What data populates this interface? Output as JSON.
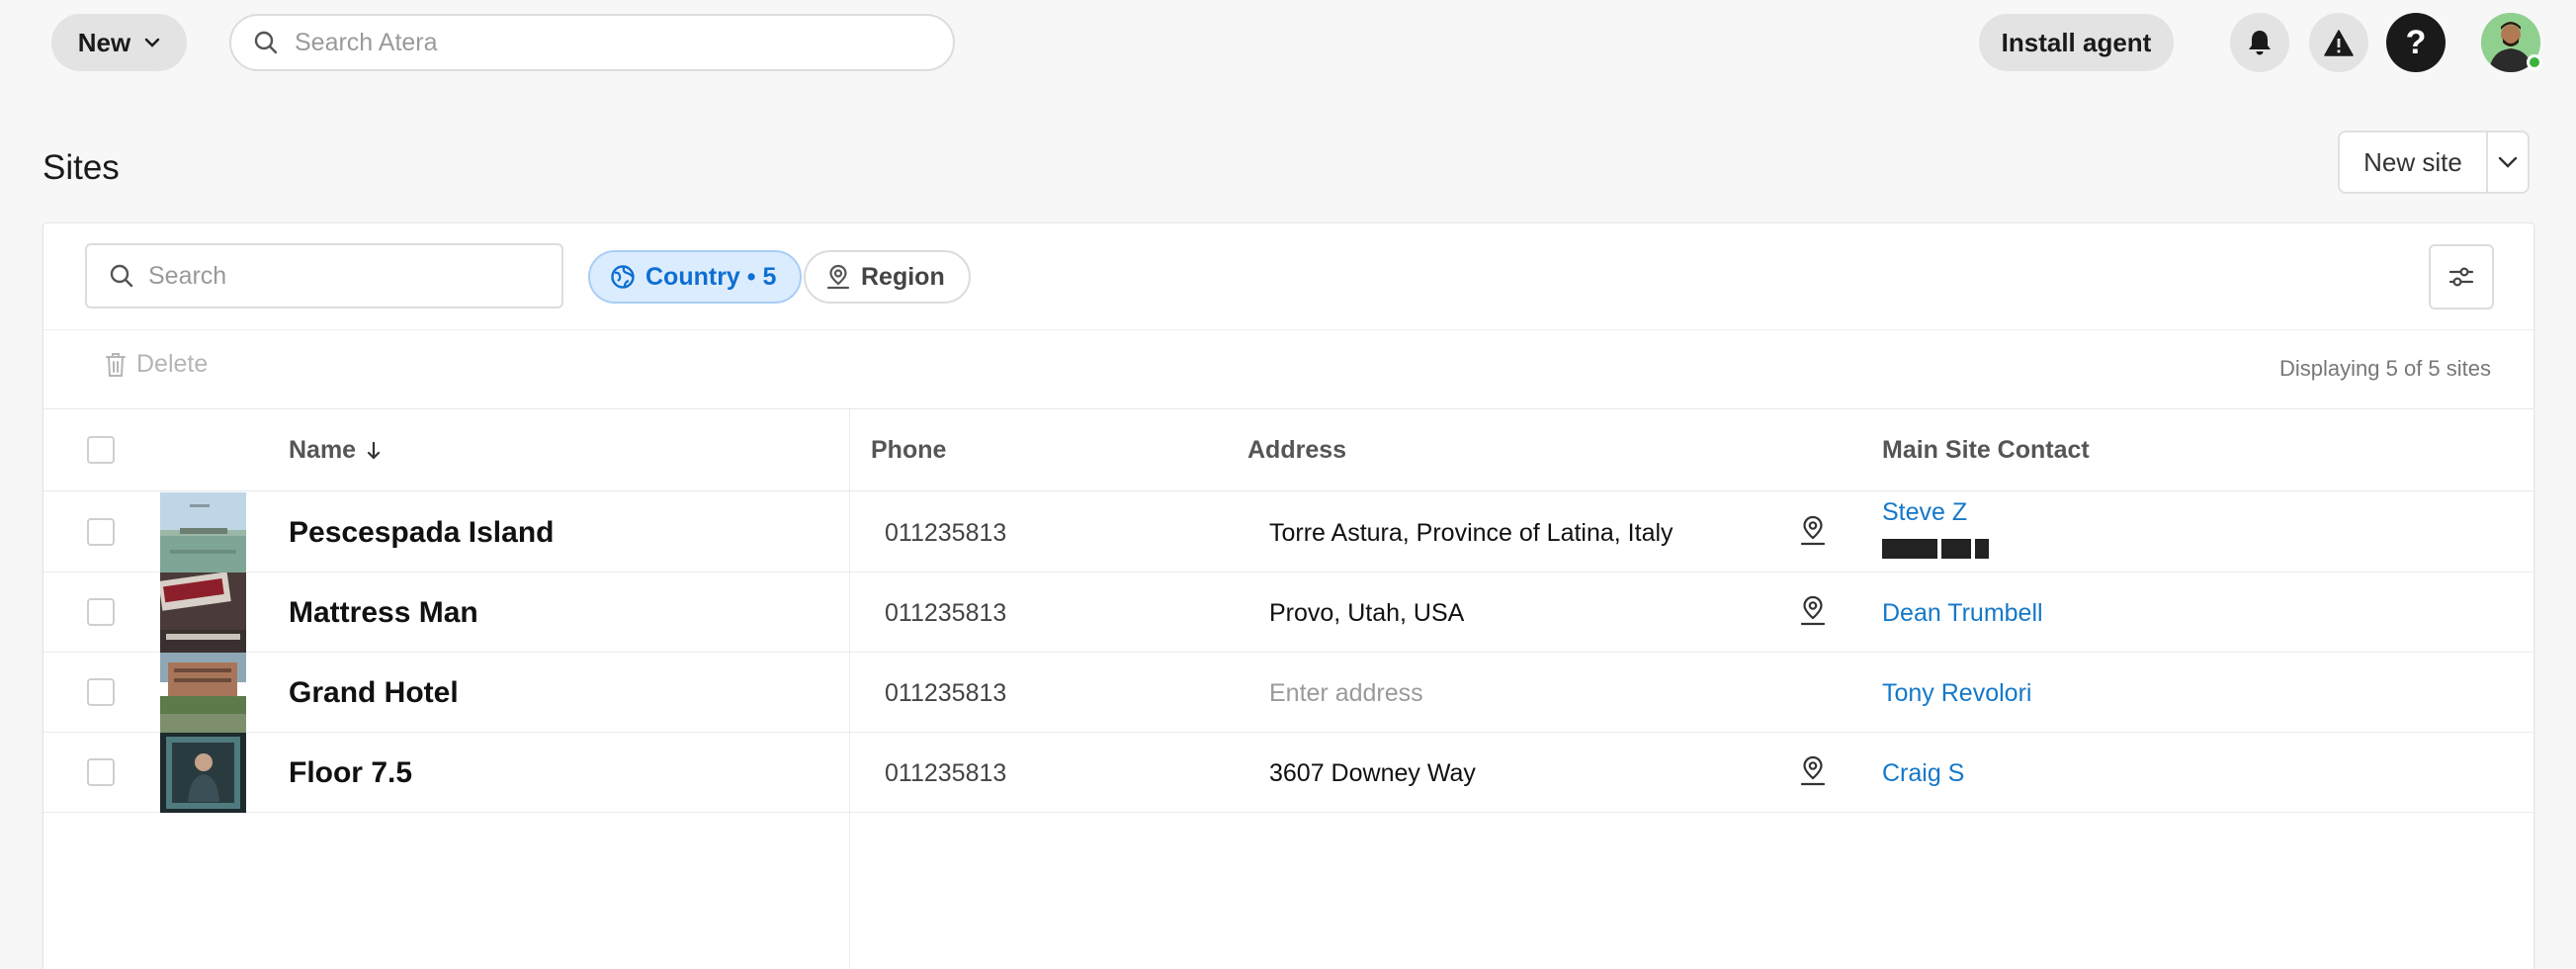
{
  "topbar": {
    "new_label": "New",
    "search_placeholder": "Search Atera",
    "install_agent_label": "Install agent",
    "help_label": "?"
  },
  "page": {
    "title": "Sites",
    "new_site_label": "New site"
  },
  "filters": {
    "search_placeholder": "Search",
    "country_chip": "Country • 5",
    "region_chip": "Region"
  },
  "actions": {
    "delete_label": "Delete",
    "display_count": "Displaying 5 of 5 sites"
  },
  "table": {
    "columns": {
      "name": "Name",
      "phone": "Phone",
      "address": "Address",
      "contact": "Main Site Contact"
    },
    "rows": [
      {
        "name": "Pescespada Island",
        "phone": "011235813",
        "address": "Torre Astura, Province of Latina, Italy",
        "contact": "Steve Z"
      },
      {
        "name": "Mattress Man",
        "phone": "011235813",
        "address": "Provo, Utah, USA",
        "contact": "Dean Trumbell"
      },
      {
        "name": "Grand Hotel",
        "phone": "011235813",
        "address": "Enter address",
        "contact": "Tony Revolori"
      },
      {
        "name": "Floor 7.5",
        "phone": "011235813",
        "address": "3607 Downey Way",
        "contact": "Craig S"
      }
    ]
  },
  "colors": {
    "accent_blue": "#1478c9",
    "chip_bg": "#dcecff",
    "status_green": "#3bb33b"
  },
  "icons": {
    "new_caret": "chevron-down-icon",
    "search": "search-icon",
    "bell": "bell-icon",
    "warning": "warning-icon",
    "help": "help-icon",
    "country": "globe-icon",
    "region": "map-pin-icon",
    "settings": "sliders-icon",
    "delete": "trash-icon",
    "sort": "arrow-down-icon"
  }
}
